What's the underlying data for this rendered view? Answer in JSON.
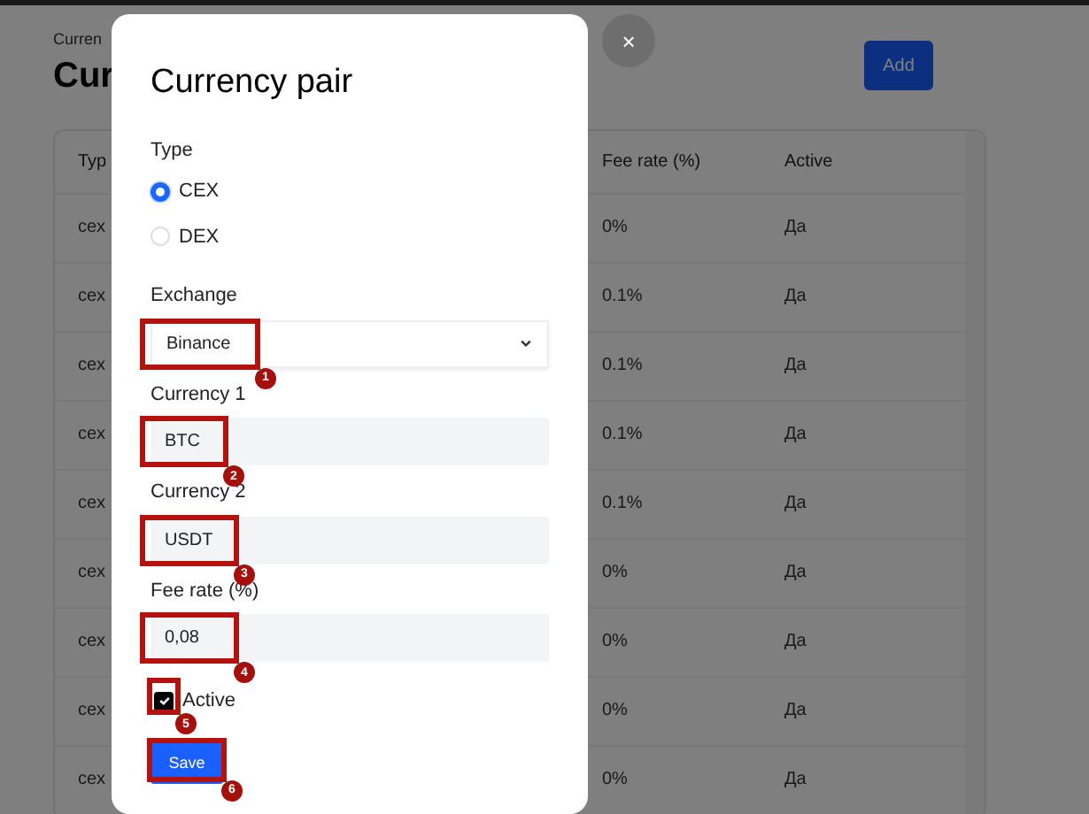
{
  "page": {
    "breadcrumb": "Curren",
    "title": "Cur",
    "add_button": "Add"
  },
  "table": {
    "columns": [
      "Typ",
      "Fee rate (%)",
      "Active"
    ],
    "rows": [
      {
        "type": "cex",
        "fee_rate": "0%",
        "active": "Да"
      },
      {
        "type": "cex",
        "fee_rate": "0.1%",
        "active": "Да"
      },
      {
        "type": "cex",
        "fee_rate": "0.1%",
        "active": "Да"
      },
      {
        "type": "cex",
        "fee_rate": "0.1%",
        "active": "Да"
      },
      {
        "type": "cex",
        "fee_rate": "0.1%",
        "active": "Да"
      },
      {
        "type": "cex",
        "fee_rate": "0%",
        "active": "Да"
      },
      {
        "type": "cex",
        "fee_rate": "0%",
        "active": "Да"
      },
      {
        "type": "cex",
        "fee_rate": "0%",
        "active": "Да"
      },
      {
        "type": "cex",
        "fee_rate": "0%",
        "active": "Да"
      }
    ]
  },
  "dialog": {
    "close_button": "×",
    "title": "Currency pair",
    "type_label": "Type",
    "type_options": [
      {
        "label": "CEX",
        "selected": true
      },
      {
        "label": "DEX",
        "selected": false
      }
    ],
    "fields": [
      {
        "kind": "select",
        "label": "Exchange",
        "value": "Binance",
        "annotation": "1"
      },
      {
        "kind": "text",
        "label": "Currency 1",
        "value": "BTC",
        "annotation": "2"
      },
      {
        "kind": "text",
        "label": "Currency 2",
        "value": "USDT",
        "annotation": "3"
      },
      {
        "kind": "text",
        "label": "Fee rate (%)",
        "value": "0,08",
        "annotation": "4"
      }
    ],
    "active": {
      "label": "Active",
      "checked": true,
      "annotation": "5"
    },
    "save_button": {
      "label": "Save",
      "annotation": "6"
    }
  }
}
